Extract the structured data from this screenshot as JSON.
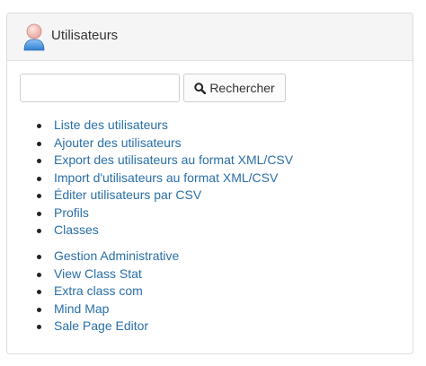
{
  "panel": {
    "title": "Utilisateurs"
  },
  "search": {
    "button_label": "Rechercher",
    "value": ""
  },
  "links_group1": [
    "Liste des utilisateurs",
    "Ajouter des utilisateurs",
    "Export des utilisateurs au format XML/CSV",
    "Import d'utilisateurs au format XML/CSV",
    "Éditer utilisateurs par CSV",
    "Profils",
    "Classes"
  ],
  "links_group2": [
    "Gestion Administrative",
    "View Class Stat",
    "Extra class com",
    "Mind Map",
    "Sale Page Editor"
  ],
  "colors": {
    "link": "#2a6fa8",
    "header_bg": "#f5f5f5",
    "border": "#dcdcdc"
  },
  "icons": {
    "header": "user-icon",
    "search": "magnifier-icon"
  }
}
